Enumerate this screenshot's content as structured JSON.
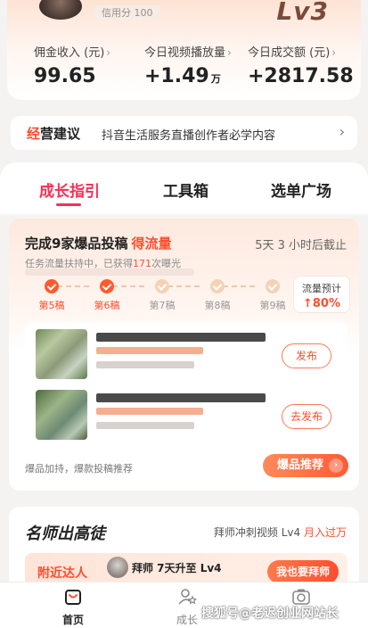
{
  "profile": {
    "badge": "信用分 100",
    "level": "Lv3"
  },
  "stats": [
    {
      "label": "佣金收入 (元)",
      "value": "99.65",
      "unit": ""
    },
    {
      "label": "今日视频播放量",
      "value": "+1.49",
      "unit": "万"
    },
    {
      "label": "今日成交额 (元)",
      "value": "+2817.58",
      "unit": ""
    }
  ],
  "advice": {
    "title_first": "经",
    "title_rest": "营建议",
    "text": "抖音生活服务直播创作者必学内容"
  },
  "tabs": [
    "成长指引",
    "工具箱",
    "选单广场"
  ],
  "task": {
    "title": "完成9家爆品投稿",
    "title_highlight": "得流量",
    "deadline": "5天 3 小时后截止",
    "sub_prefix": "任务流量扶持中，已获得",
    "sub_num": "171",
    "sub_suffix": "次曝光",
    "steps": [
      {
        "label": "第5稿",
        "done": true
      },
      {
        "label": "第6稿",
        "done": true
      },
      {
        "label": "第7稿",
        "done": false
      },
      {
        "label": "第8稿",
        "done": false
      },
      {
        "label": "第9稿",
        "done": false
      }
    ],
    "flow_label": "流量预计",
    "flow_value": "↑80%",
    "publish_labels": [
      "发布",
      "去发布"
    ],
    "footer_text": "爆品加持，爆款投稿推荐",
    "footer_button": "爆品推荐"
  },
  "mentor": {
    "title": "名师出高徒",
    "right_prefix": "拜师冲刺视频 Lv4 ",
    "right_highlight": "月入过万",
    "nearby_label": "附近达人",
    "nearby_text": "拜师 7天升至 Lv4",
    "nearby_button": "我也要拜师"
  },
  "nav": [
    {
      "label": "首页",
      "icon": "home-bag-icon",
      "active": true
    },
    {
      "label": "成长",
      "icon": "growth-icon",
      "active": false
    },
    {
      "label": "",
      "icon": "camera-icon",
      "active": false
    }
  ],
  "watermark": "搜狐号@老迟创业网站长",
  "colors": {
    "accent": "#fe2c55",
    "orange": "#ff4d2e"
  }
}
